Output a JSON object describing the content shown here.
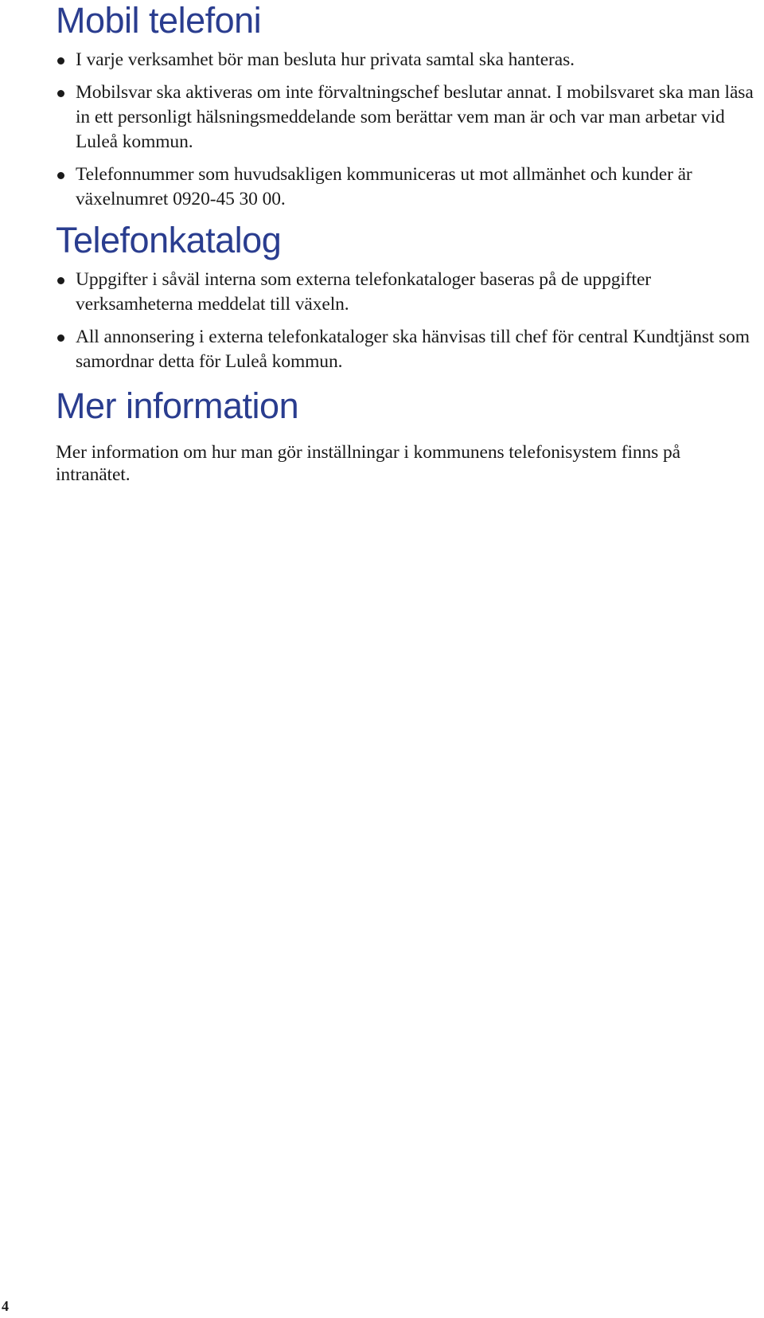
{
  "sections": [
    {
      "heading": "Mobil telefoni",
      "bullets": [
        "I varje verksamhet bör man besluta hur privata samtal ska hanteras.",
        "Mobilsvar ska aktiveras om inte förvaltningschef beslutar annat. I mobilsvaret ska man läsa in ett personligt hälsningsmeddelande som berättar vem man är och var man arbetar vid Luleå kommun.",
        "Telefonnummer som huvudsakligen kommuniceras ut mot allmänhet och kunder är växelnumret 0920-45 30 00."
      ]
    },
    {
      "heading": "Telefonkatalog",
      "bullets": [
        "Uppgifter i såväl interna som externa telefonkataloger baseras på de uppgifter verksamheterna meddelat till växeln.",
        "All annonsering i externa telefonkataloger ska hänvisas till chef för central Kundtjänst som samordnar detta för Luleå kommun."
      ]
    },
    {
      "heading": "Mer information",
      "paragraph": "Mer information om hur man gör inställningar i kommunens telefonisystem finns på intranätet."
    }
  ],
  "page_number": "4",
  "colors": {
    "heading": "#2a3d8f",
    "body_text": "#1a1a1a"
  }
}
